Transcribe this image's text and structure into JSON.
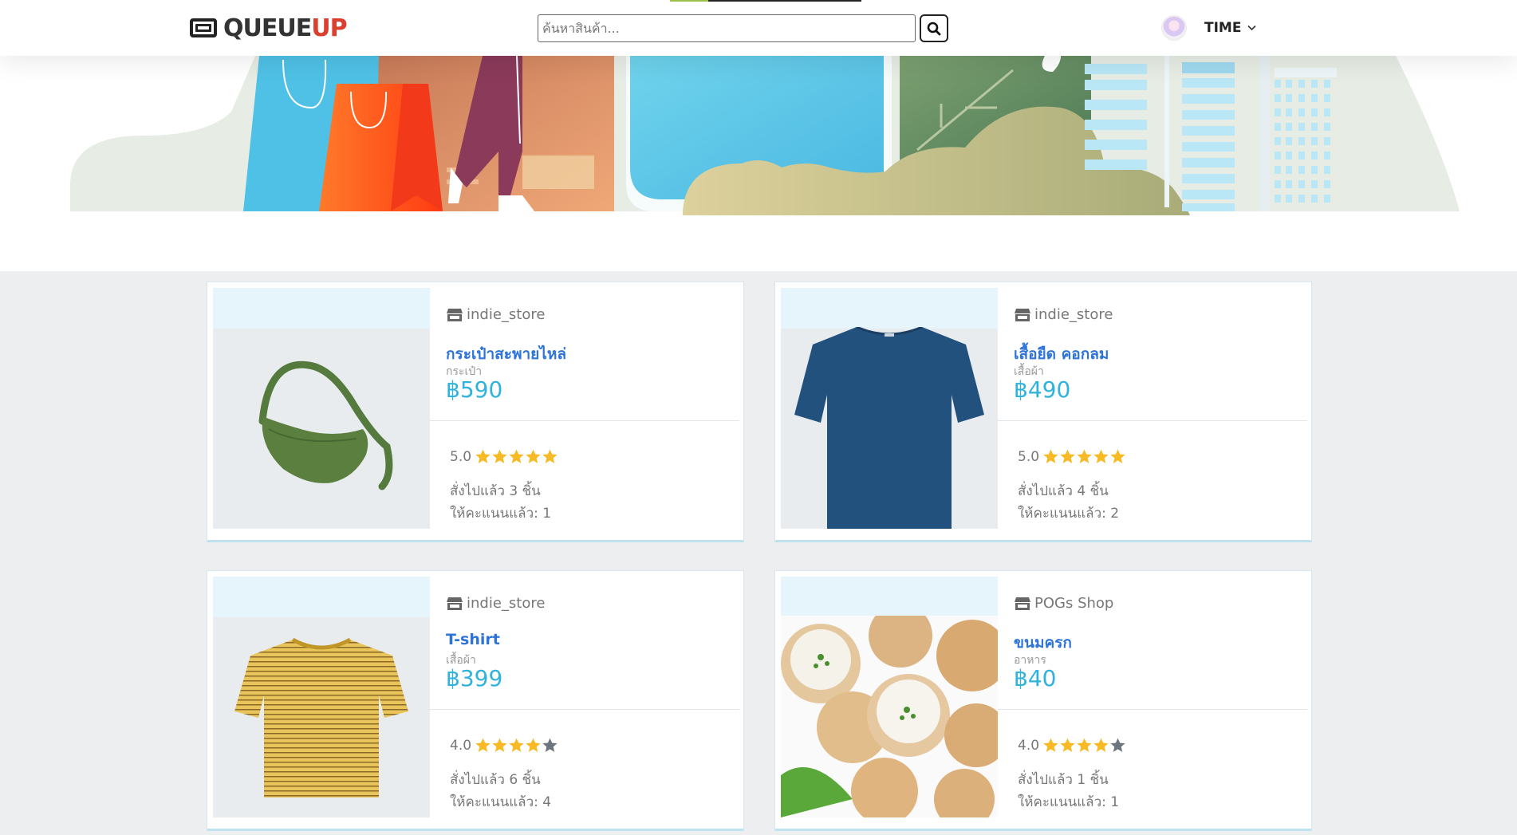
{
  "header": {
    "logo_queue": "QUEUE",
    "logo_up": "UP",
    "search_placeholder": "ค้นหาสินค้า...",
    "user_name": "TIME",
    "logo_icon": "ticket-icon",
    "search_icon": "search-icon",
    "dropdown_icon": "chevron-down-icon"
  },
  "products": [
    {
      "store": "indie_store",
      "name": "กระเป๋าสะพายไหล่",
      "category": "กระเป๋า",
      "price": "฿590",
      "rating_text": "5.0",
      "rating": 5,
      "sold": "สั่งไปแล้ว 3 ชิ้น",
      "reviews": "ให้คะแนนแล้ว: 1",
      "image": "green shoulder bag"
    },
    {
      "store": "indie_store",
      "name": "เสื้อยืด คอกลม",
      "category": "เสื้อผ้า",
      "price": "฿490",
      "rating_text": "5.0",
      "rating": 5,
      "sold": "สั่งไปแล้ว 4 ชิ้น",
      "reviews": "ให้คะแนนแล้ว: 2",
      "image": "navy t-shirt"
    },
    {
      "store": "indie_store",
      "name": "T-shirt",
      "category": "เสื้อผ้า",
      "price": "฿399",
      "rating_text": "4.0",
      "rating": 4,
      "sold": "สั่งไปแล้ว 6 ชิ้น",
      "reviews": "ให้คะแนนแล้ว: 4",
      "image": "yellow striped t-shirt"
    },
    {
      "store": "POGs Shop",
      "name": "ขนมครก",
      "category": "อาหาร",
      "price": "฿40",
      "rating_text": "4.0",
      "rating": 4,
      "sold": "สั่งไปแล้ว 1 ชิ้น",
      "reviews": "ให้คะแนนแล้ว: 1",
      "image": "khanom krok dessert"
    }
  ],
  "colors": {
    "product_name": "#2e74d8",
    "price": "#2fb3dd",
    "logo_up": "#d94030",
    "star_filled": "#f7b924",
    "star_empty": "#6c757d"
  }
}
